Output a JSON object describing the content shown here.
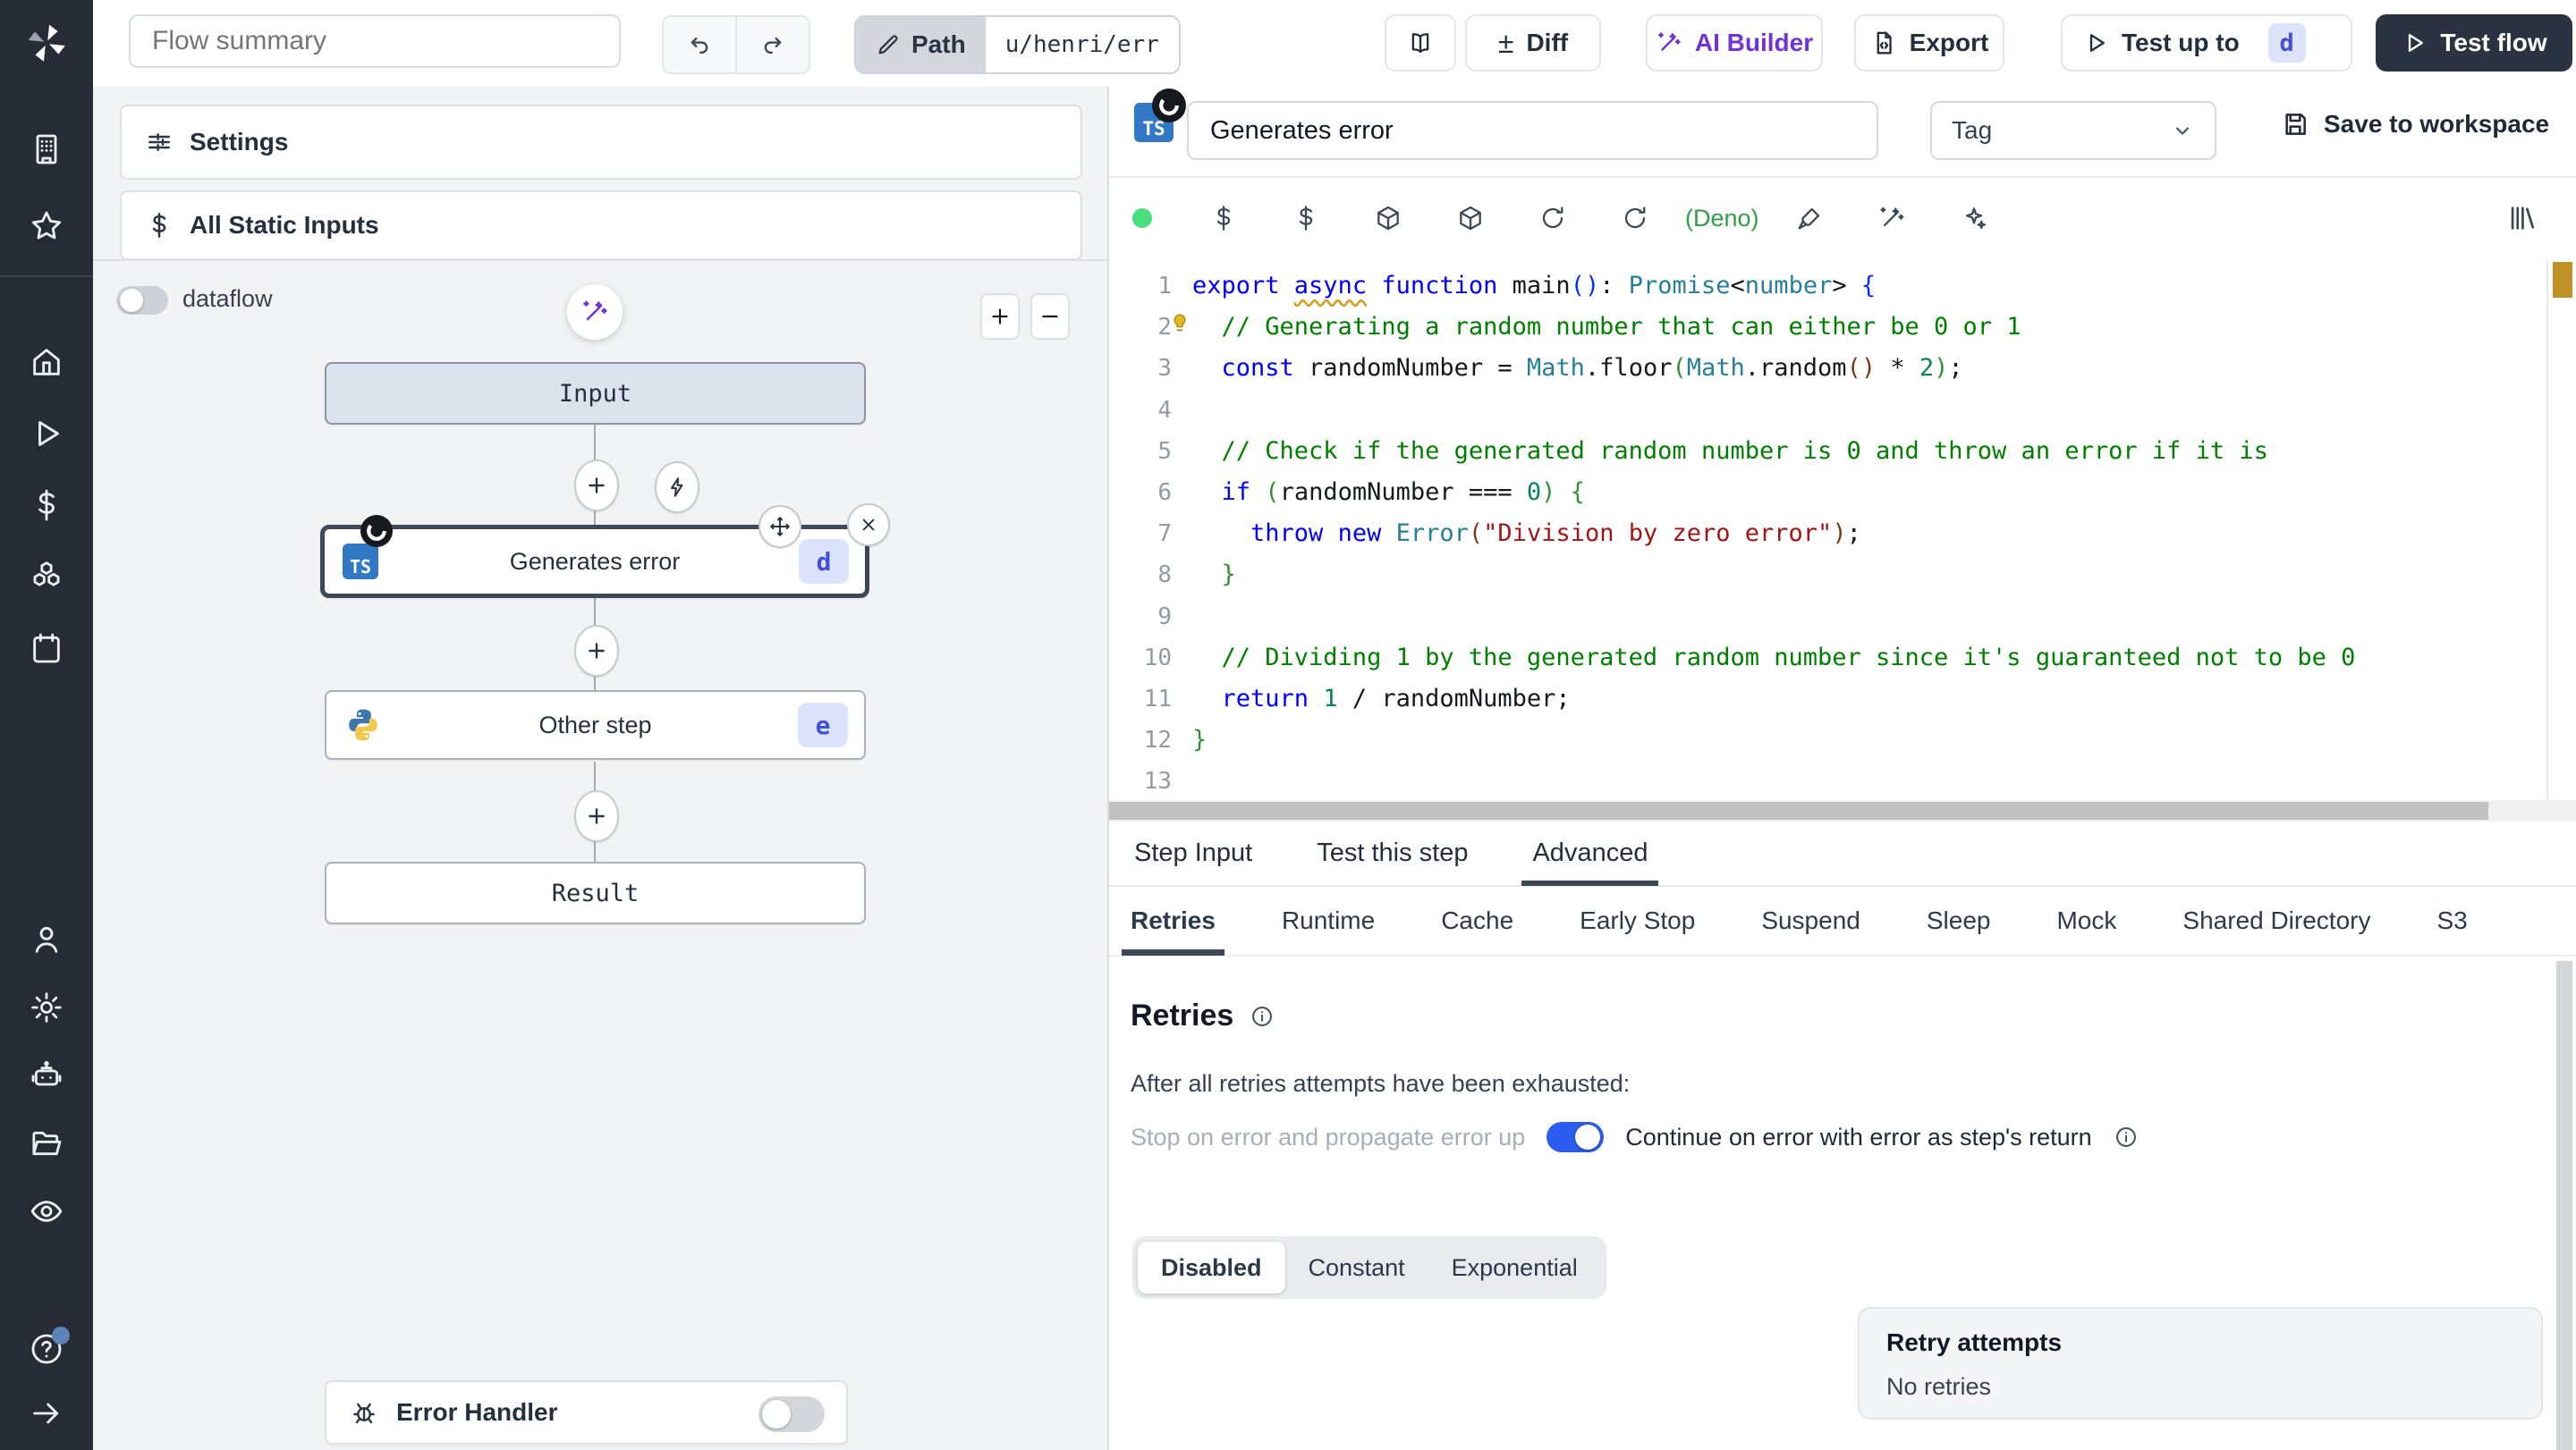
{
  "colors": {
    "accent_blue": "#2d5cf0",
    "purple": "#7233d6",
    "deno_green": "#2f9e44",
    "sidebar_bg": "#262b36",
    "dark_button": "#2b3242",
    "indigo_badge_bg": "#dde3fc",
    "indigo_badge_text": "#4150d8",
    "warn_marker": "#bf9226",
    "status_dot": "#4ade80"
  },
  "sidebar": {
    "top": [
      {
        "icon": "building"
      },
      {
        "icon": "star"
      }
    ],
    "mid": [
      {
        "icon": "home"
      },
      {
        "icon": "play"
      },
      {
        "icon": "dollar"
      },
      {
        "icon": "cubes"
      },
      {
        "icon": "calendar"
      }
    ],
    "bottom": [
      {
        "icon": "user"
      },
      {
        "icon": "gear"
      },
      {
        "icon": "robot"
      },
      {
        "icon": "folder-open"
      },
      {
        "icon": "eye"
      }
    ],
    "footer": [
      {
        "icon": "help-circle",
        "badge": true
      },
      {
        "icon": "arrow-right"
      }
    ]
  },
  "topbar": {
    "flow_summary_placeholder": "Flow summary",
    "path_label": "Path",
    "path_value": "u/henri/err",
    "diff_label": "Diff",
    "diff_sign": "±",
    "ai_builder_label": "AI Builder",
    "export_label": "Export",
    "test_up_to_label": "Test up to",
    "test_up_to_badge": "d",
    "test_flow_label": "Test flow"
  },
  "left_panel": {
    "settings_label": "Settings",
    "static_inputs_label": "All Static Inputs",
    "dataflow_label": "dataflow",
    "error_handler_label": "Error Handler",
    "nodes": {
      "input_label": "Input",
      "step1_title": "Generates error",
      "step1_badge": "d",
      "step2_title": "Other step",
      "step2_badge": "e",
      "result_label": "Result"
    }
  },
  "step": {
    "title": "Generates error",
    "tag_placeholder": "Tag",
    "save_label": "Save to workspace",
    "runtime_label": "(Deno)"
  },
  "editor_toolbar": [
    {
      "icon": "status-dot",
      "kind": "dot"
    },
    {
      "icon": "dollar"
    },
    {
      "icon": "dollar"
    },
    {
      "icon": "package"
    },
    {
      "icon": "package"
    },
    {
      "icon": "rotate"
    },
    {
      "icon": "rotate"
    },
    {
      "kind": "label",
      "text": "(Deno)"
    },
    {
      "icon": "brush"
    },
    {
      "icon": "wand",
      "color": "purple"
    },
    {
      "icon": "sparkles",
      "color": "purple"
    }
  ],
  "code": {
    "lines": [
      {
        "tokens": [
          {
            "t": "export ",
            "c": "k"
          },
          {
            "t": "async",
            "c": "ku"
          },
          {
            "t": " ",
            "c": "p"
          },
          {
            "t": "function ",
            "c": "k"
          },
          {
            "t": "main",
            "c": "p"
          },
          {
            "t": "(",
            "c": "b1"
          },
          {
            "t": ")",
            "c": "b1"
          },
          {
            "t": ": ",
            "c": "p"
          },
          {
            "t": "Promise",
            "c": "t"
          },
          {
            "t": "<",
            "c": "p"
          },
          {
            "t": "number",
            "c": "t"
          },
          {
            "t": "> ",
            "c": "p"
          },
          {
            "t": "{",
            "c": "b1"
          }
        ]
      },
      {
        "bulb": true,
        "tokens": [
          {
            "t": "  ",
            "c": "p"
          },
          {
            "t": "// Generating a random number that can either be 0 or 1",
            "c": "c"
          }
        ]
      },
      {
        "tokens": [
          {
            "t": "  ",
            "c": "p"
          },
          {
            "t": "const",
            "c": "k"
          },
          {
            "t": " randomNumber = ",
            "c": "p"
          },
          {
            "t": "Math",
            "c": "t"
          },
          {
            "t": ".floor",
            "c": "p"
          },
          {
            "t": "(",
            "c": "b2"
          },
          {
            "t": "Math",
            "c": "t"
          },
          {
            "t": ".random",
            "c": "p"
          },
          {
            "t": "(",
            "c": "b3"
          },
          {
            "t": ")",
            "c": "b3"
          },
          {
            "t": " * ",
            "c": "p"
          },
          {
            "t": "2",
            "c": "n"
          },
          {
            "t": ")",
            "c": "b2"
          },
          {
            "t": ";",
            "c": "p"
          }
        ]
      },
      {
        "tokens": []
      },
      {
        "tokens": [
          {
            "t": "  ",
            "c": "p"
          },
          {
            "t": "// Check if the generated random number is 0 and throw an error if it is",
            "c": "c"
          }
        ]
      },
      {
        "tokens": [
          {
            "t": "  ",
            "c": "p"
          },
          {
            "t": "if",
            "c": "k"
          },
          {
            "t": " ",
            "c": "p"
          },
          {
            "t": "(",
            "c": "b2"
          },
          {
            "t": "randomNumber === ",
            "c": "p"
          },
          {
            "t": "0",
            "c": "n"
          },
          {
            "t": ")",
            "c": "b2"
          },
          {
            "t": " ",
            "c": "p"
          },
          {
            "t": "{",
            "c": "b2"
          }
        ]
      },
      {
        "tokens": [
          {
            "t": "    ",
            "c": "p"
          },
          {
            "t": "throw",
            "c": "k"
          },
          {
            "t": " ",
            "c": "p"
          },
          {
            "t": "new",
            "c": "k"
          },
          {
            "t": " ",
            "c": "p"
          },
          {
            "t": "Error",
            "c": "t"
          },
          {
            "t": "(",
            "c": "b3"
          },
          {
            "t": "\"Division by zero error\"",
            "c": "s"
          },
          {
            "t": ")",
            "c": "b3"
          },
          {
            "t": ";",
            "c": "p"
          }
        ]
      },
      {
        "tokens": [
          {
            "t": "  ",
            "c": "p"
          },
          {
            "t": "}",
            "c": "b2"
          }
        ]
      },
      {
        "tokens": []
      },
      {
        "tokens": [
          {
            "t": "  ",
            "c": "p"
          },
          {
            "t": "// Dividing 1 by the generated random number since it's guaranteed not to be 0",
            "c": "c"
          }
        ]
      },
      {
        "tokens": [
          {
            "t": "  ",
            "c": "p"
          },
          {
            "t": "return",
            "c": "k"
          },
          {
            "t": " ",
            "c": "p"
          },
          {
            "t": "1",
            "c": "n"
          },
          {
            "t": " / randomNumber;",
            "c": "p"
          }
        ]
      },
      {
        "tokens": [
          {
            "t": "}",
            "c": "b2"
          }
        ]
      },
      {
        "tokens": []
      }
    ]
  },
  "tabs": {
    "main": [
      {
        "label": "Step Input"
      },
      {
        "label": "Test this step"
      },
      {
        "label": "Advanced",
        "active": true
      }
    ],
    "advanced": [
      {
        "label": "Retries",
        "active": true
      },
      {
        "label": "Runtime"
      },
      {
        "label": "Cache"
      },
      {
        "label": "Early Stop"
      },
      {
        "label": "Suspend"
      },
      {
        "label": "Sleep"
      },
      {
        "label": "Mock"
      },
      {
        "label": "Shared Directory"
      },
      {
        "label": "S3"
      }
    ]
  },
  "retries": {
    "title": "Retries",
    "exhausted_text": "After all retries attempts have been exhausted:",
    "toggle_off_label": "Stop on error and propagate error up",
    "toggle_on_label": "Continue on error with error as step's return",
    "toggle_state": "on",
    "modes": [
      {
        "label": "Disabled",
        "active": true
      },
      {
        "label": "Constant"
      },
      {
        "label": "Exponential"
      }
    ],
    "attempts_title": "Retry attempts",
    "attempts_value": "No retries"
  }
}
